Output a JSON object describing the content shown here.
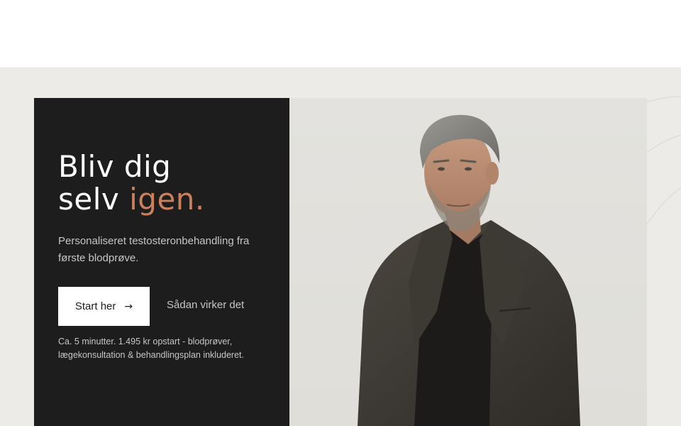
{
  "hero": {
    "headline_line1": "Bliv dig",
    "headline_line2": "selv",
    "headline_accent": "igen.",
    "subtitle": "Personaliseret testosteronbehandling fra første blodprøve.",
    "primary_cta": "Start her",
    "primary_cta_icon": "arrow-right-icon",
    "secondary_cta": "Sådan virker det",
    "note": "Ca. 5 minutter. 1.495 kr opstart - blodprøver, lægekonsultation & behandlingsplan inkluderet."
  },
  "colors": {
    "panel_dark": "#1e1d1e",
    "accent": "#c9805b",
    "page_bg": "#ecebe7",
    "text_muted": "#c8c6c3"
  }
}
